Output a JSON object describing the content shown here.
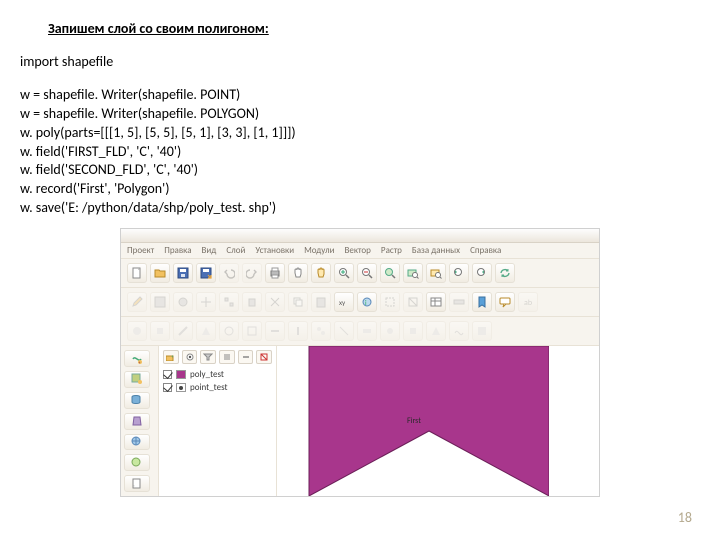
{
  "heading": "Запишем слой со своим полигоном:",
  "code": {
    "l1": "import shapefile",
    "l2": "w = shapefile. Writer(shapefile. POINT)",
    "l3": "w = shapefile. Writer(shapefile. POLYGON)",
    "l4": "w. poly(parts=[[[1, 5], [5, 5], [5, 1], [3, 3], [1, 1]]])",
    "l5": "w. field('FIRST_FLD', 'C', '40')",
    "l6": "w. field('SECOND_FLD', 'C', '40')",
    "l7": "w. record('First', 'Polygon')",
    "l8": "w. save('E: /python/data/shp/poly_test. shp')"
  },
  "menu": {
    "m1": "Проект",
    "m2": "Правка",
    "m3": "Вид",
    "m4": "Слой",
    "m5": "Установки",
    "m6": "Модули",
    "m7": "Вектор",
    "m8": "Растр",
    "m9": "База данных",
    "m10": "Справка"
  },
  "layers": {
    "name1": "poly_test",
    "name2": "point_test"
  },
  "polygon_label": "First",
  "page_number": "18",
  "icons": {
    "new": "new-doc-icon",
    "open": "open-folder-icon",
    "save": "save-icon",
    "saveas": "save-as-icon",
    "undo": "undo-icon",
    "redo": "redo-icon",
    "pan": "pan-hand-icon",
    "zoomin": "zoom-in-icon",
    "zoomout": "zoom-out-icon",
    "extent": "zoom-extent-icon",
    "refresh": "refresh-icon",
    "identify": "identify-icon",
    "measure": "measure-icon",
    "select": "select-icon",
    "deselect": "deselect-icon",
    "edit": "edit-pencil-icon",
    "addfeat": "add-feature-icon",
    "move": "move-feature-icon",
    "node": "node-tool-icon",
    "cut": "cut-icon",
    "copy": "copy-icon",
    "paste": "paste-icon",
    "label_xy": "xy-label-icon",
    "tips": "tips-icon",
    "print": "print-icon",
    "vec": "add-vector-icon",
    "rast": "add-raster-icon",
    "db": "add-database-icon",
    "wms": "add-wms-icon",
    "newlayer": "new-layer-icon",
    "remove": "remove-layer-icon",
    "group": "add-group-icon",
    "expand": "expand-icon",
    "collapse": "collapse-icon"
  }
}
